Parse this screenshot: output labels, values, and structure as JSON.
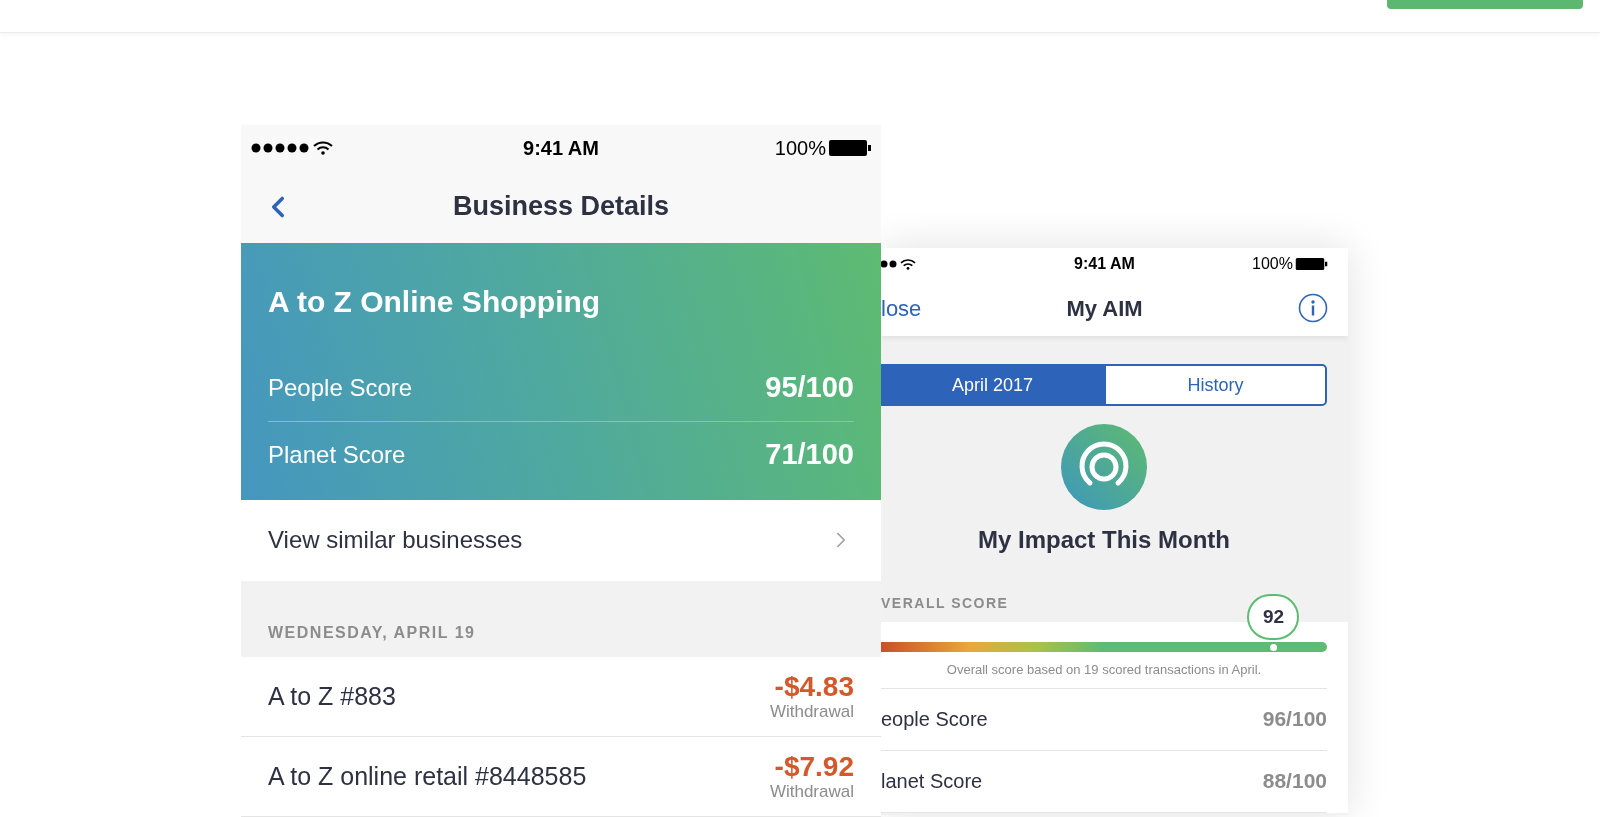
{
  "left_phone": {
    "status": {
      "time": "9:41 AM",
      "battery": "100%"
    },
    "nav": {
      "title": "Business Details"
    },
    "business": {
      "name": "A to Z Online Shopping",
      "scores": [
        {
          "label": "People Score",
          "value": "95/100"
        },
        {
          "label": "Planet Score",
          "value": "71/100"
        }
      ]
    },
    "link": "View similar businesses",
    "section_header": "WEDNESDAY, APRIL 19",
    "transactions": [
      {
        "name": "A to Z #883",
        "amount": "-$4.83",
        "type": "Withdrawal"
      },
      {
        "name": "A to Z online retail #8448585",
        "amount": "-$7.92",
        "type": "Withdrawal"
      }
    ]
  },
  "right_phone": {
    "status": {
      "time": "9:41 AM",
      "battery": "100%"
    },
    "nav": {
      "left_button": "lose",
      "title": "My AIM"
    },
    "tabs": [
      {
        "label": "April 2017",
        "selected": true
      },
      {
        "label": "History",
        "selected": false
      }
    ],
    "heading": "My Impact This Month",
    "overall": {
      "label": "VERALL SCORE",
      "score": "92",
      "level": 0.88,
      "note": "Overall score based on 19 scored transactions in April."
    },
    "scores": [
      {
        "label": "eople Score",
        "value": "96/100"
      },
      {
        "label": "lanet Score",
        "value": "88/100"
      }
    ]
  }
}
